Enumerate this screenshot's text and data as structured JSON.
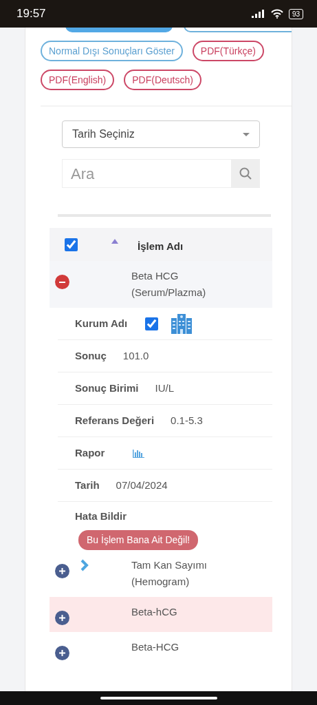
{
  "status_bar": {
    "time": "19:57",
    "battery": "93"
  },
  "filter_buttons": [
    {
      "label": "Normal Dışı Sonuçları Göster",
      "kind": "info"
    },
    {
      "label": "PDF(Türkçe)",
      "kind": "pdf"
    },
    {
      "label": "PDF(English)",
      "kind": "pdf"
    },
    {
      "label": "PDF(Deutsch)",
      "kind": "pdf"
    }
  ],
  "date_select": {
    "value": "Tarih Seçiniz"
  },
  "search": {
    "placeholder": "Ara"
  },
  "table": {
    "header": {
      "checked": true,
      "label": "İşlem Adı"
    },
    "rows": [
      {
        "name": "Beta HCG (Serum/Plazma)",
        "expanded": true,
        "highlighted": false,
        "chevron": false,
        "details": [
          {
            "kind": "institution",
            "label": "Kurum Adı",
            "checked": true
          },
          {
            "kind": "text",
            "label": "Sonuç",
            "value": "101.0"
          },
          {
            "kind": "text",
            "label": "Sonuç Birimi",
            "value": "IU/L"
          },
          {
            "kind": "text",
            "label": "Referans Değeri",
            "value": "0.1-5.3"
          },
          {
            "kind": "report",
            "label": "Rapor"
          },
          {
            "kind": "text",
            "label": "Tarih",
            "value": "07/04/2024"
          },
          {
            "kind": "action",
            "label": "Hata Bildir",
            "button": "Bu İşlem Bana Ait Değil!"
          }
        ]
      },
      {
        "name": "Tam Kan Sayımı (Hemogram)",
        "expanded": false,
        "highlighted": false,
        "chevron": true
      },
      {
        "name": "Beta-hCG",
        "expanded": false,
        "highlighted": true,
        "chevron": false
      },
      {
        "name": "Beta-HCG",
        "expanded": false,
        "highlighted": false,
        "chevron": false
      }
    ]
  }
}
